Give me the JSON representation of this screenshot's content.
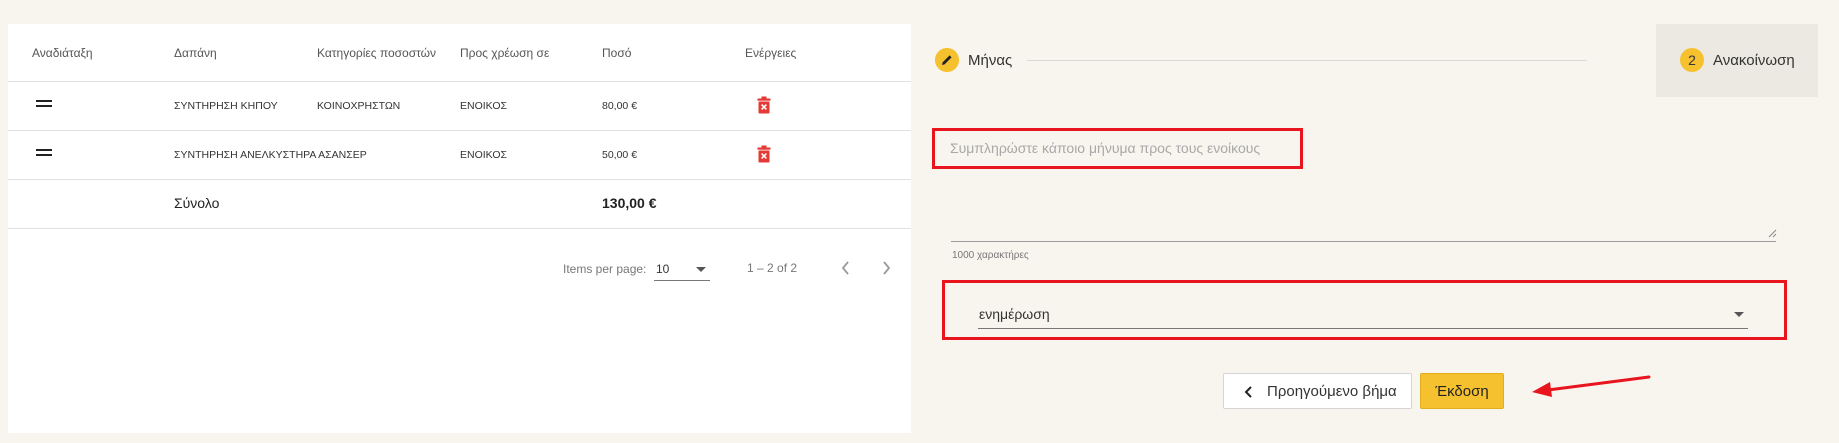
{
  "table": {
    "columns": [
      "Αναδιάταξη",
      "Δαπάνη",
      "Κατηγορίες ποσοστών",
      "Προς χρέωση σε",
      "Ποσό",
      "Ενέργειες"
    ],
    "rows": [
      {
        "expense": "ΣΥΝΤΗΡΗΣΗ ΚΗΠΟΥ",
        "category": "ΚΟΙΝΟΧΡΗΣΤΩΝ",
        "charge_to": "ΕΝΟΙΚΟΣ",
        "amount": "80,00 €"
      },
      {
        "expense": "ΣΥΝΤΗΡΗΣΗ ΑΝΕΛΚΥΣΤΗΡΑ ΑΣΑΝΣΕΡ",
        "category": "",
        "charge_to": "ΕΝΟΙΚΟΣ",
        "amount": "50,00 €"
      }
    ],
    "total_label": "Σύνολο",
    "total_amount": "130,00 €"
  },
  "paginator": {
    "items_per_page_label": "Items per page:",
    "page_size": "10",
    "range": "1 – 2 of 2"
  },
  "stepper": {
    "step1_label": "Μήνας",
    "step2_number": "2",
    "step2_label": "Ανακοίνωση"
  },
  "form": {
    "message_placeholder": "Συμπληρώστε κάποιο μήνυμα προς τους ενοίκους",
    "char_hint": "1000 χαρακτήρες",
    "type_value": "ενημέρωση"
  },
  "actions": {
    "prev_label": "Προηγούμενο βήμα",
    "issue_label": "Έκδοση"
  },
  "colors": {
    "accent": "#f6c12f",
    "highlight": "#e8141e",
    "delete": "#e53935"
  }
}
